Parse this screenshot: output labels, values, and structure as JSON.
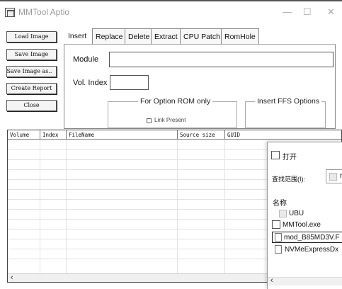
{
  "window": {
    "title": "MMTool Aptio",
    "minimize_glyph": "—",
    "maximize_glyph": "☐",
    "close_glyph": "✕"
  },
  "left_buttons": {
    "load_image": "Load Image",
    "save_image": "Save Image",
    "save_image_as": "Save Image as..",
    "create_report": "Create Report",
    "close": "Close"
  },
  "tabs": [
    "Insert",
    "Replace",
    "Delete",
    "Extract",
    "CPU Patch",
    "RomHole"
  ],
  "active_tab": "Insert",
  "insert_panel": {
    "module_label": "Module",
    "module_value": "",
    "vol_index_label": "Vol. Index",
    "vol_index_value": "",
    "option_rom_group": "For Option ROM only",
    "link_present_label": "Link Present",
    "ffs_group": "Insert FFS Options"
  },
  "table": {
    "columns": [
      "Volume",
      "Index",
      "FileName",
      "Source size",
      "GUID"
    ],
    "rows": []
  },
  "open_dialog": {
    "title": "打开",
    "look_in_label": "查找范围(I):",
    "look_in_value": "r",
    "name_header": "名称",
    "files": [
      {
        "name": "UBU",
        "type": "folder"
      },
      {
        "name": "MMTool.exe",
        "type": "exe"
      },
      {
        "name": "mod_B85MD3V.F",
        "type": "file",
        "selected": true
      },
      {
        "name": "NVMeExpressDx",
        "type": "file"
      }
    ],
    "scroll_left": "‹"
  },
  "table_scroll_left": "‹",
  "colors": {
    "border_dark": "#555555",
    "title_gray": "#9a9a9a",
    "selection_border": "#1e1e1e"
  }
}
